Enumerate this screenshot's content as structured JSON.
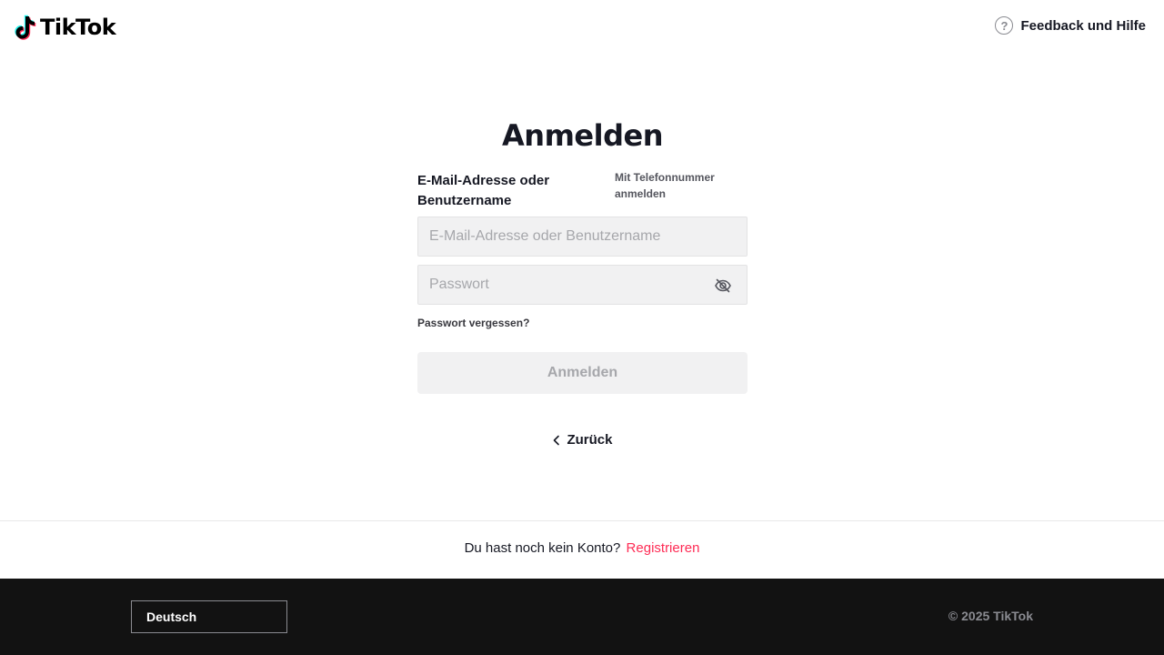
{
  "header": {
    "logo_text": "TikTok",
    "help_label": "Feedback und Hilfe"
  },
  "login": {
    "title": "Anmelden",
    "field_label": "E-Mail-Adresse oder Benutzername",
    "alt_login_label": "Mit Telefonnummer anmelden",
    "username": {
      "placeholder": "E-Mail-Adresse oder Benutzername",
      "value": ""
    },
    "password": {
      "placeholder": "Passwort",
      "value": ""
    },
    "forgot_label": "Passwort vergessen?",
    "submit_label": "Anmelden",
    "back_label": "Zurück"
  },
  "signup": {
    "prompt": "Du hast noch kein Konto?",
    "link_label": "Registrieren"
  },
  "footer": {
    "language": "Deutsch",
    "copyright": "© 2025 TikTok"
  },
  "colors": {
    "accent": "#fe2c55",
    "text": "#161823",
    "input_bg": "#f1f1f2",
    "footer_bg": "#121212"
  },
  "icons": {
    "logo": "tiktok-note-icon",
    "help": "question-circle-icon",
    "password_toggle": "eye-off-icon",
    "back": "chevron-left-icon"
  }
}
